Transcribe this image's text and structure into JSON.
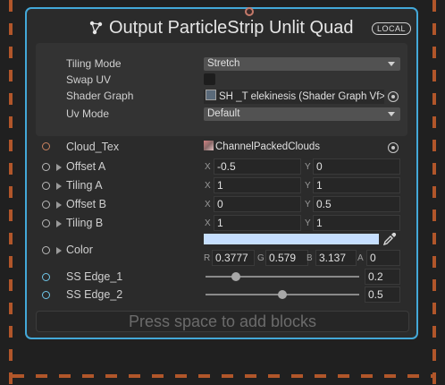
{
  "node": {
    "title": "Output ParticleStrip Unlit Quad",
    "badge": "LOCAL"
  },
  "settings": {
    "tiling_mode": {
      "label": "Tiling Mode",
      "value": "Stretch"
    },
    "swap_uv": {
      "label": "Swap UV",
      "checked": false
    },
    "shader_graph": {
      "label": "Shader Graph",
      "value": "SH _T elekinesis (Shader Graph Vf>"
    },
    "uv_mode": {
      "label": "Uv Mode",
      "value": "Default"
    }
  },
  "properties": {
    "cloud_tex": {
      "label": "Cloud_Tex",
      "value": "ChannelPackedClouds"
    },
    "offset_a": {
      "label": "Offset A",
      "x": "-0.5",
      "y": "0"
    },
    "tiling_a": {
      "label": "Tiling A",
      "x": "1",
      "y": "1"
    },
    "offset_b": {
      "label": "Offset B",
      "x": "0",
      "y": "0.5"
    },
    "tiling_b": {
      "label": "Tiling B",
      "x": "1",
      "y": "1"
    },
    "color": {
      "label": "Color",
      "swatch": "#c6dfff",
      "r": "0.3777",
      "g": "0.579",
      "b": "3.137",
      "a": "0"
    },
    "ss_edge_1": {
      "label": "SS Edge_1",
      "value": "0.2",
      "fraction": 0.2
    },
    "ss_edge_2": {
      "label": "SS Edge_2",
      "value": "0.5",
      "fraction": 0.5
    }
  },
  "axis_labels": {
    "x": "X",
    "y": "Y",
    "r": "R",
    "g": "G",
    "b": "B",
    "a": "A"
  },
  "footer": {
    "hint": "Press space to add blocks"
  },
  "colors": {
    "accent": "#43a8d8",
    "port_orange": "#c9825f",
    "port_blue": "#6fc6e8",
    "dash": "#b1562a"
  }
}
